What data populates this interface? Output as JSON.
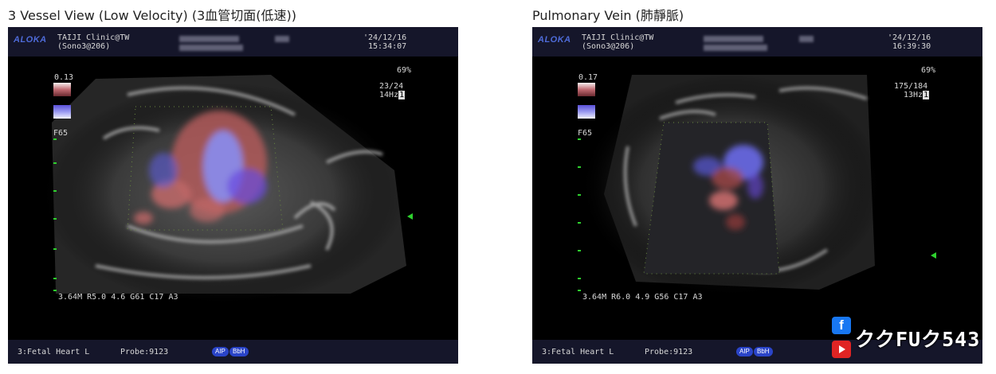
{
  "left_panel": {
    "caption": "3 Vessel View (Low Velocity) (3血管切面(低速))",
    "brand": "ALOKA",
    "clinic": "TAIJI Clinic@TW",
    "sono": "(Sono3@206)",
    "date": "'24/12/16",
    "time": "15:34:07",
    "scale_value": "0.13",
    "percent": "69%",
    "frame_ratio": "23/24",
    "freq": "14Hz",
    "freq_box": "1",
    "filter": "F65",
    "params": "3.64M R5.0 4.6 G61 C17 A3",
    "preset": "3:Fetal Heart L",
    "probe": "Probe:9123",
    "badge_aip": "AIP",
    "badge_bbh": "BbH"
  },
  "right_panel": {
    "caption": "Pulmonary Vein (肺靜脈)",
    "brand": "ALOKA",
    "clinic": "TAIJI Clinic@TW",
    "sono": "(Sono3@206)",
    "date": "'24/12/16",
    "time": "16:39:30",
    "scale_value": "0.17",
    "percent": "69%",
    "frame_ratio": "175/184",
    "freq": "13Hz",
    "freq_box": "1",
    "filter": "F65",
    "params": "3.64M R6.0 4.9 G56 C17 A3",
    "preset": "3:Fetal Heart L",
    "probe": "Probe:9123",
    "badge_aip": "AIP",
    "badge_bbh": "BbH"
  },
  "watermark": {
    "text": "ククFUク543",
    "icons": [
      "facebook-icon",
      "youtube-icon"
    ]
  }
}
